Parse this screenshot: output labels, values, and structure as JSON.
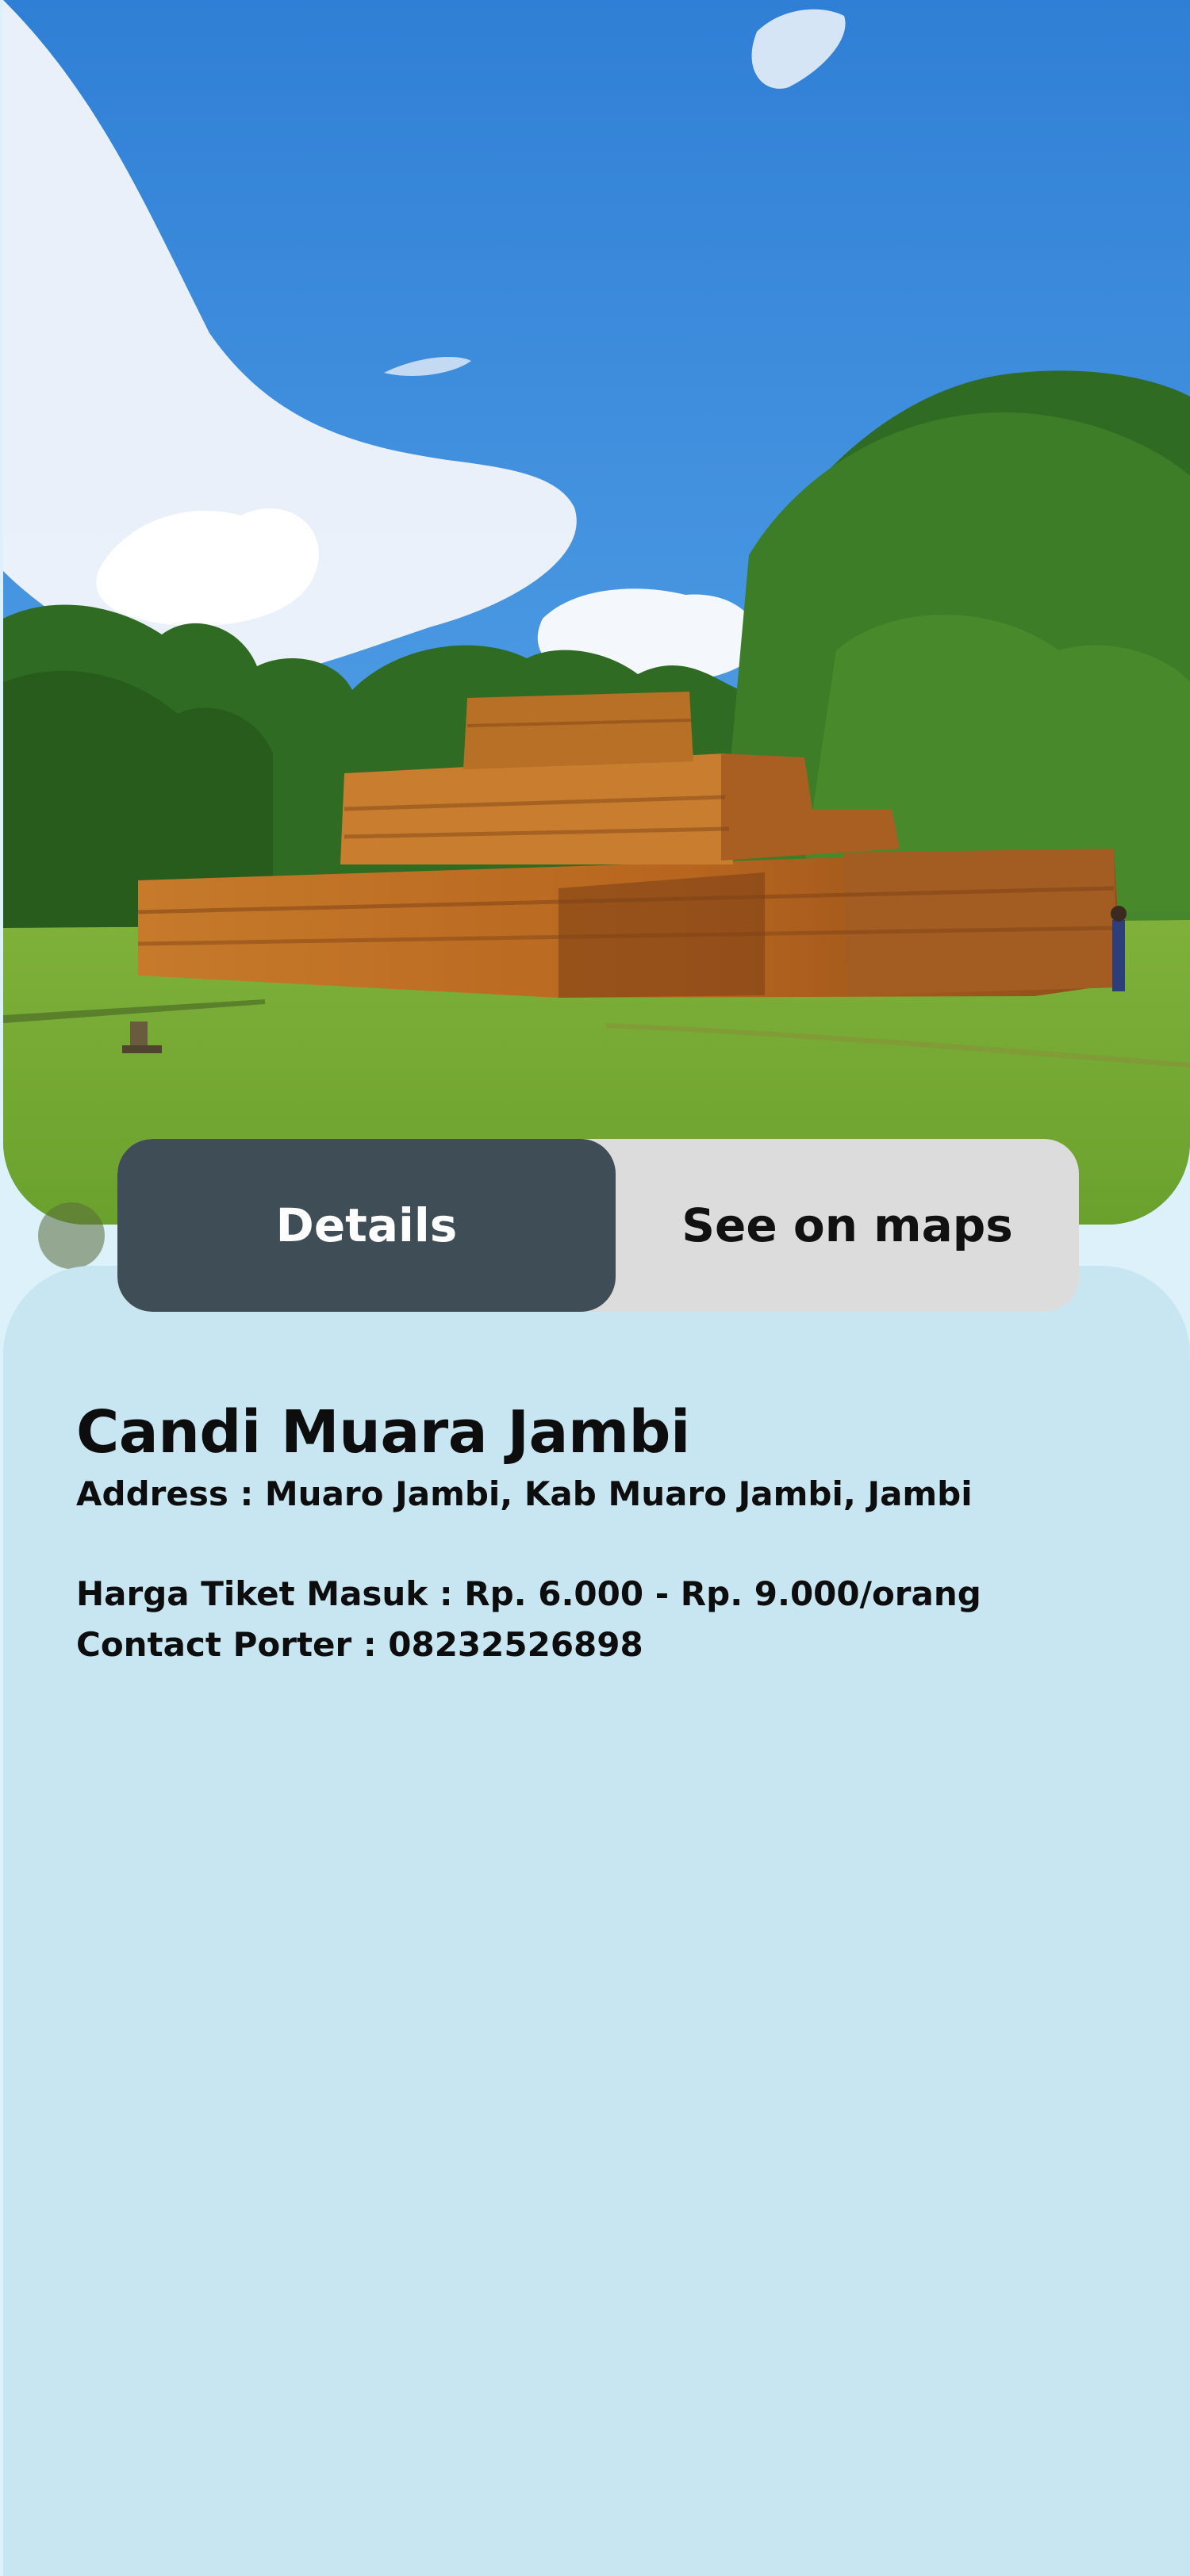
{
  "hero": {
    "image_icon": "temple-photo"
  },
  "tabs": {
    "details_label": "Details",
    "maps_label": "See on maps",
    "active": "Details",
    "active_color": "#3f4e56",
    "inactive_color": "#dcdcdc"
  },
  "place": {
    "name": "Candi Muara Jambi",
    "address": "Address : Muaro Jambi, Kab Muaro Jambi, Jambi",
    "ticket": "Harga Tiket Masuk : Rp. 6.000 - Rp. 9.000/orang",
    "contact": "Contact Porter : 08232526898"
  },
  "colors": {
    "background": "#dcf1f9",
    "card": "#c8e5f2",
    "text": "#0d0d0d"
  }
}
